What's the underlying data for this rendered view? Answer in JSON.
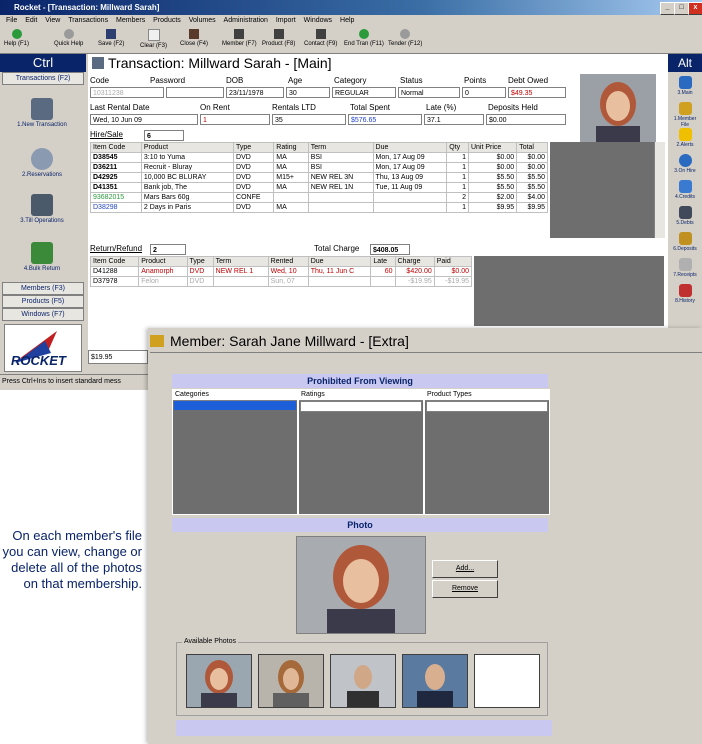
{
  "window": {
    "title": "Rocket - [Transaction: Millward Sarah]",
    "menu": [
      "File",
      "Edit",
      "View",
      "Transactions",
      "Members",
      "Products",
      "Volumes",
      "Administration",
      "Import",
      "Windows",
      "Help"
    ],
    "toolbar": [
      "Help (F1)",
      "Quick Help",
      "Save (F2)",
      "Clear (F3)",
      "Close (F4)",
      "Member (F7)",
      "Product (F8)",
      "Contact (F9)",
      "End Tran (F11)",
      "Tender (F12)"
    ]
  },
  "left_panel": {
    "header": "Ctrl",
    "tab_transactions": "Transactions (F2)",
    "buttons": [
      "1.New Transaction",
      "2.Reservations",
      "3.Till Operations",
      "4.Bulk Return"
    ],
    "tabs": [
      "Members (F3)",
      "Products (F5)",
      "Windows (F7)"
    ],
    "logo_text": "ROCKET",
    "bottom_field": "$19.95"
  },
  "status_bar": "Press Ctrl+Ins to insert standard mess",
  "right_panel": {
    "header": "Alt",
    "buttons": [
      "3.Main",
      "1.Member File",
      "2.Alerts",
      "3.On Hire",
      "4.Credits",
      "5.Debts",
      "6.Deposits",
      "7.Receipts",
      "8.History"
    ]
  },
  "transaction": {
    "title": "Transaction: Millward Sarah - [Main]",
    "labels": {
      "code": "Code",
      "password": "Password",
      "dob": "DOB",
      "age": "Age",
      "category": "Category",
      "status": "Status",
      "points": "Points",
      "debt_owed": "Debt Owed",
      "last_rental": "Last Rental Date",
      "on_rent": "On Rent",
      "rentals_ltd": "Rentals LTD",
      "total_spent": "Total Spent",
      "late": "Late (%)",
      "deposits_held": "Deposits Held"
    },
    "values": {
      "code": "10311238",
      "password": "",
      "dob": "23/11/1978",
      "age": "30",
      "category": "REGULAR",
      "status": "Normal",
      "points": "0",
      "debt_owed": "$49.35",
      "last_rental": "Wed, 10 Jun 09",
      "on_rent": "1",
      "rentals_ltd": "35",
      "total_spent": "$576.65",
      "late": "37.1",
      "deposits_held": "$0.00"
    },
    "hire_label": "Hire/Sale",
    "hire_count": "6",
    "hire_columns": [
      "Item Code",
      "Product",
      "Type",
      "Rating",
      "Term",
      "Due",
      "Qty",
      "Unit Price",
      "Total"
    ],
    "hire_rows": [
      [
        "D38545",
        "3:10 to Yuma",
        "DVD",
        "MA",
        "BSI",
        "Mon, 17 Aug 09",
        "1",
        "$0.00",
        "$0.00"
      ],
      [
        "D36211",
        "Recruit - Bluray",
        "DVD",
        "MA",
        "BSI",
        "Mon, 17 Aug 09",
        "1",
        "$0.00",
        "$0.00"
      ],
      [
        "D42925",
        "10,000 BC BLURAY",
        "DVD",
        "M15+",
        "NEW REL 3N",
        "Thu, 13 Aug 09",
        "1",
        "$5.50",
        "$5.50"
      ],
      [
        "D41351",
        "Bank job, The",
        "DVD",
        "MA",
        "NEW REL 1N",
        "Tue, 11 Aug 09",
        "1",
        "$5.50",
        "$5.50"
      ],
      [
        "93682015",
        "Mars Bars 60g",
        "CONFE",
        "",
        "",
        "",
        "2",
        "$2.00",
        "$4.00"
      ],
      [
        "D38298",
        "2 Days in Paris",
        "DVD",
        "MA",
        "",
        "",
        "1",
        "$9.95",
        "$9.95"
      ]
    ],
    "return_label": "Return/Refund",
    "return_count": "2",
    "total_charge_label": "Total Charge",
    "total_charge": "$408.05",
    "return_columns": [
      "Item Code",
      "Product",
      "Type",
      "Term",
      "Rented",
      "Due",
      "Late",
      "Charge",
      "Paid"
    ],
    "return_rows": [
      [
        "D41288",
        "Anamorph",
        "DVD",
        "NEW REL 1",
        "Wed, 10",
        "Thu, 11 Jun C",
        "60",
        "$420.00",
        "$0.00"
      ],
      [
        "D37978",
        "Felon",
        "DVD",
        "",
        "Sun, 07",
        "",
        "",
        "-$19.95",
        "-$19.95"
      ]
    ]
  },
  "member": {
    "title": "Member: Sarah Jane Millward - [Extra]",
    "prohibited_title": "Prohibited From Viewing",
    "columns": [
      "Categories",
      "Ratings",
      "Product Types"
    ],
    "photo_title": "Photo",
    "add_button": "Add...",
    "remove_button": "Remove",
    "available_photos_label": "Available Photos"
  },
  "description": "On each member's file you can view, change or delete all of the photos on that membership.",
  "colors": {
    "accent": "#0a246a",
    "band": "#c8c8f0",
    "alert_red": "#c00000"
  }
}
